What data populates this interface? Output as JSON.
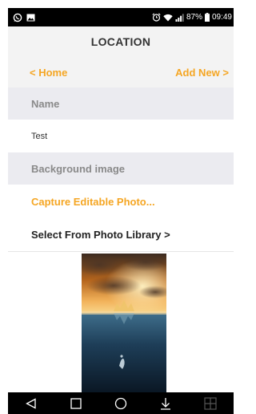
{
  "status_bar": {
    "battery_percent": "87%",
    "time": "09:49",
    "icons": [
      "whatsapp-icon",
      "gallery-icon",
      "alarm-icon",
      "wifi-icon",
      "signal-icon",
      "battery-icon"
    ]
  },
  "header": {
    "title": "LOCATION"
  },
  "nav": {
    "back_label": "< Home",
    "add_label": "Add New >"
  },
  "form": {
    "name_header": "Name",
    "name_value": "Test",
    "background_header": "Background image",
    "capture_label": "Capture Editable Photo...",
    "library_label": "Select From Photo Library >"
  },
  "preview": {
    "image": "ocean-sunset-crown-photo"
  },
  "system_nav": {
    "buttons": [
      "back-icon",
      "recents-icon",
      "home-icon",
      "notifications-icon",
      "dual-window-icon"
    ]
  },
  "colors": {
    "accent": "#f5a623",
    "header_bg": "#f3f3f3",
    "section_bg": "#ebebf0",
    "section_text": "#8a8a8a"
  }
}
